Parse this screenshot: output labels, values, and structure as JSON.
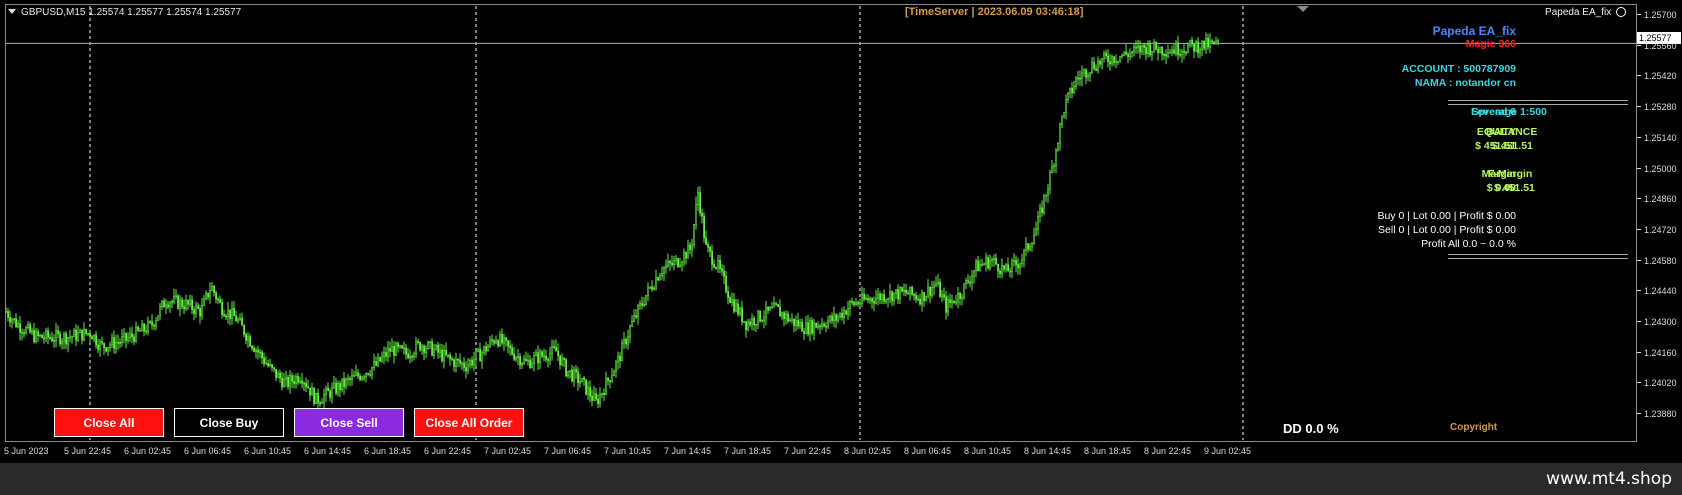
{
  "symbol": {
    "label": "GBPUSD,M15  1.25574 1.25577 1.25574 1.25577"
  },
  "timeserver": "[TimeServer | 2023.06.09 03:46:18]",
  "ea": {
    "title": "Papeda EA_fix",
    "name": "Papeda EA_fix",
    "magic": "Magic  366"
  },
  "account": {
    "number": "ACCOUNT : 500787909",
    "name": "NAMA : notandor cn",
    "leverage": "Leverage  1:500",
    "spread": "Spread  6",
    "balance_label": "BALANCE",
    "balance_value": "$ 451.51",
    "equity_label": "EQUITY",
    "equity_value": "$ 451.51",
    "fmargin_label": "F-Margin",
    "fmargin_value": "$ 451.51",
    "margin_label": "Margin",
    "margin_value": "$ 0.00",
    "buy_line": "Buy   0  |  Lot 0.00  |  Profit $ 0.00",
    "sell_line": "Sell   0  |  Lot 0.00  |  Profit $ 0.00",
    "profit_all": "Profit All 0.0 ~ 0.0 %"
  },
  "buttons": {
    "close_all": "Close All",
    "close_buy": "Close Buy",
    "close_sell": "Close Sell",
    "close_all_order": "Close All Order"
  },
  "dd": "DD 0.0 %",
  "copyright": "Copyright",
  "footer": "www.mt4.shop",
  "current_price": "1.25577",
  "price_scale": [
    "1.25700",
    "1.25560",
    "1.25420",
    "1.25280",
    "1.25140",
    "1.25000",
    "1.24860",
    "1.24720",
    "1.24580",
    "1.24440",
    "1.24300",
    "1.24160",
    "1.24020",
    "1.23880"
  ],
  "time_axis": [
    "5 Jun 2023",
    "5 Jun 22:45",
    "6 Jun 02:45",
    "6 Jun 06:45",
    "6 Jun 10:45",
    "6 Jun 14:45",
    "6 Jun 18:45",
    "6 Jun 22:45",
    "7 Jun 02:45",
    "7 Jun 06:45",
    "7 Jun 10:45",
    "7 Jun 14:45",
    "7 Jun 18:45",
    "7 Jun 22:45",
    "8 Jun 02:45",
    "8 Jun 06:45",
    "8 Jun 10:45",
    "8 Jun 14:45",
    "8 Jun 18:45",
    "8 Jun 22:45",
    "9 Jun 02:45"
  ],
  "colors": {
    "candle": "#66ee44",
    "bid_line": "#b0b0b0",
    "period_sep": "#ffffff"
  },
  "chart_data": {
    "type": "line",
    "series_desc": "GBPUSD M15 price path (approximate close)",
    "ylim": [
      1.2388,
      1.2572
    ],
    "points": [
      [
        0,
        1.2443
      ],
      [
        10,
        1.2438
      ],
      [
        30,
        1.2432
      ],
      [
        60,
        1.2432
      ],
      [
        85,
        1.2434
      ],
      [
        95,
        1.2428
      ],
      [
        120,
        1.2431
      ],
      [
        145,
        1.2437
      ],
      [
        160,
        1.2448
      ],
      [
        180,
        1.2446
      ],
      [
        195,
        1.2443
      ],
      [
        205,
        1.2454
      ],
      [
        215,
        1.2445
      ],
      [
        230,
        1.244
      ],
      [
        245,
        1.243
      ],
      [
        265,
        1.2418
      ],
      [
        280,
        1.2412
      ],
      [
        295,
        1.2416
      ],
      [
        310,
        1.2405
      ],
      [
        330,
        1.241
      ],
      [
        350,
        1.2415
      ],
      [
        370,
        1.242
      ],
      [
        385,
        1.2427
      ],
      [
        400,
        1.2425
      ],
      [
        415,
        1.2429
      ],
      [
        430,
        1.2426
      ],
      [
        445,
        1.2422
      ],
      [
        460,
        1.242
      ],
      [
        475,
        1.2425
      ],
      [
        490,
        1.2432
      ],
      [
        505,
        1.2426
      ],
      [
        520,
        1.2421
      ],
      [
        535,
        1.2424
      ],
      [
        550,
        1.2426
      ],
      [
        560,
        1.2418
      ],
      [
        575,
        1.2413
      ],
      [
        590,
        1.2404
      ],
      [
        600,
        1.2412
      ],
      [
        612,
        1.2422
      ],
      [
        625,
        1.2437
      ],
      [
        640,
        1.245
      ],
      [
        655,
        1.2461
      ],
      [
        670,
        1.2464
      ],
      [
        685,
        1.247
      ],
      [
        692,
        1.2494
      ],
      [
        700,
        1.247
      ],
      [
        712,
        1.2462
      ],
      [
        725,
        1.2448
      ],
      [
        740,
        1.2438
      ],
      [
        755,
        1.2441
      ],
      [
        770,
        1.2444
      ],
      [
        785,
        1.2439
      ],
      [
        800,
        1.2436
      ],
      [
        815,
        1.2438
      ],
      [
        830,
        1.244
      ],
      [
        845,
        1.2446
      ],
      [
        860,
        1.2448
      ],
      [
        880,
        1.245
      ],
      [
        900,
        1.2451
      ],
      [
        915,
        1.2449
      ],
      [
        930,
        1.2455
      ],
      [
        940,
        1.2445
      ],
      [
        955,
        1.2451
      ],
      [
        970,
        1.2462
      ],
      [
        985,
        1.2465
      ],
      [
        1000,
        1.246
      ],
      [
        1015,
        1.2465
      ],
      [
        1030,
        1.2478
      ],
      [
        1045,
        1.2502
      ],
      [
        1058,
        1.253
      ],
      [
        1070,
        1.2542
      ],
      [
        1085,
        1.2548
      ],
      [
        1100,
        1.2551
      ],
      [
        1120,
        1.2553
      ],
      [
        1140,
        1.2556
      ],
      [
        1160,
        1.2555
      ],
      [
        1180,
        1.2556
      ],
      [
        1200,
        1.2557
      ],
      [
        1213,
        1.2557
      ]
    ]
  }
}
